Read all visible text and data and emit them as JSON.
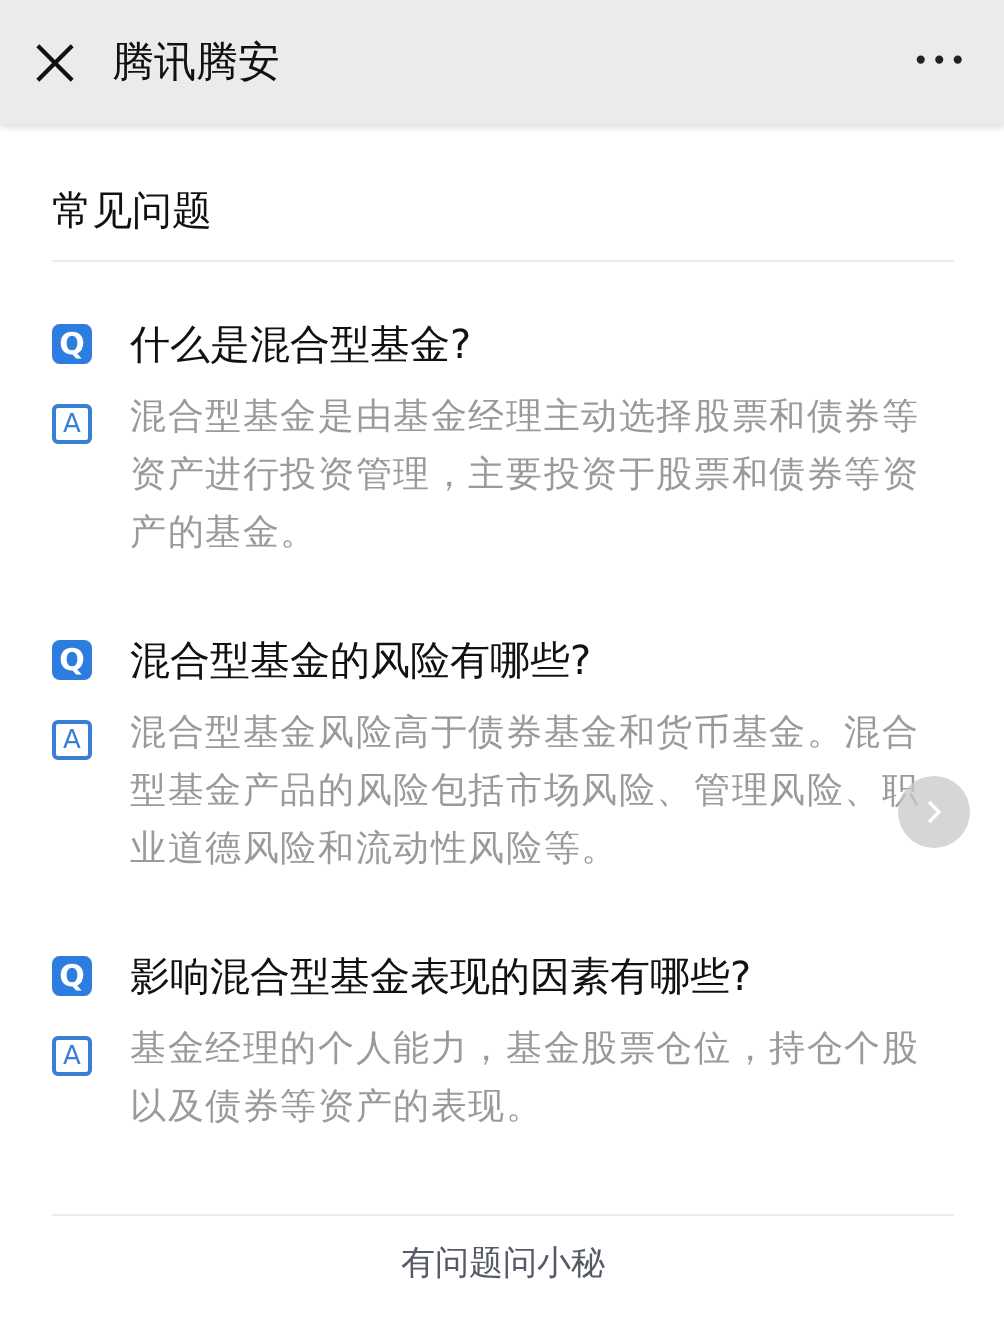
{
  "nav_bar": {
    "title": "腾讯腾安",
    "more": "•••"
  },
  "section_title": "常见问题",
  "faq": [
    {
      "q_mark": "Q",
      "question": "什么是混合型基金?",
      "a_mark": "A",
      "answer": "混合型基金是由基金经理主动选择股票和债券等资产进行投资管理，主要投资于股票和债券等资产的基金。"
    },
    {
      "q_mark": "Q",
      "question": "混合型基金的风险有哪些?",
      "a_mark": "A",
      "answer": "混合型基金风险高于债券基金和货币基金。混合型基金产品的风险包括市场风险、管理风险、职业道德风险和流动性风险等。"
    },
    {
      "q_mark": "Q",
      "question": "影响混合型基金表现的因素有哪些?",
      "a_mark": "A",
      "answer": "基金经理的个人能力，基金股票仓位，持仓个股以及债券等资产的表现。"
    }
  ],
  "footer_link": "有问题问小秘"
}
